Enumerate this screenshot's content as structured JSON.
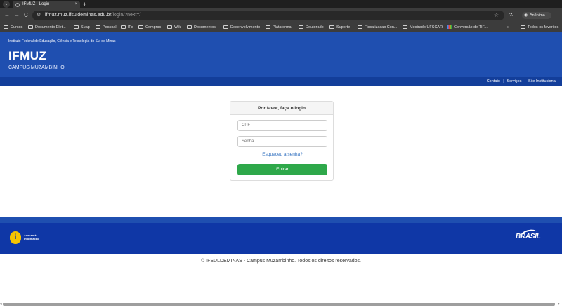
{
  "browser": {
    "tab_title": "IFMUZ - Login",
    "tab_close": "×",
    "new_tab": "+",
    "menu": "⌄",
    "back": "←",
    "forward": "→",
    "reload": "C",
    "url_host": "ifmuz.muz.ifsuldeminas.edu.br",
    "url_path": "/login/?next=/",
    "star": "☆",
    "profile_label": "Anônima",
    "bookmarks": [
      "Cursos",
      "Documento Elet...",
      "Suap",
      "Pessoal",
      "IFs",
      "Compras",
      "Wiki",
      "Documentos",
      "Desenvolvimento",
      "Plataforma",
      "Doutorado",
      "Suporte",
      "Fiscalizacao Con...",
      "Mestrado UFSCAR",
      "Conversão de TIF...",
      "»",
      "Todos os favoritos"
    ]
  },
  "header": {
    "institution": "Instituto Federal de Educação, Ciência e Tecnologia do Sul de Minas",
    "logo": "IFMUZ",
    "campus": "CAMPUS MUZAMBINHO"
  },
  "nav": {
    "links": [
      "Contato",
      "Serviços",
      "Site Institucional"
    ],
    "separator": "|"
  },
  "login": {
    "title": "Por favor, faça o login",
    "cpf_placeholder": "CPF",
    "password_placeholder": "Senha",
    "forgot_label": "Esqueceu a senha?",
    "submit_label": "Entrar"
  },
  "footer": {
    "access_info_line1": "Acesso à",
    "access_info_line2": "Informação",
    "access_info_icon": "i",
    "brand": "BRASIL",
    "copyright": "© IFSULDEMINAS - Campus Muzambinho. Todos os direitos reservados."
  },
  "colors": {
    "header_blue": "#1f4fb0",
    "nav_blue": "#133e9a",
    "footer_blue": "#0f37a6",
    "submit_green": "#2ea84a",
    "link_blue": "#2f6fbf"
  }
}
